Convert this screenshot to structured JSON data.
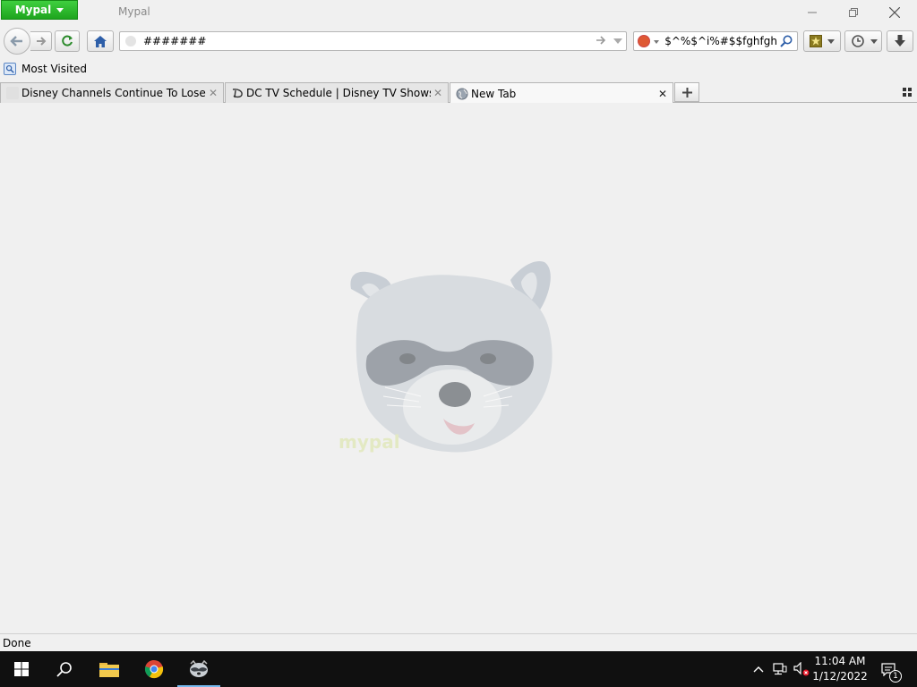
{
  "window": {
    "app_menu_label": "Mypal",
    "title": "Mypal",
    "controls": [
      "minimize-icon",
      "restore-icon",
      "close-icon"
    ]
  },
  "navbar": {
    "back_icon": "back-arrow-icon",
    "forward_icon": "forward-arrow-icon",
    "reload_icon": "reload-icon",
    "home_icon": "home-icon",
    "url_value": "#######",
    "search_value": "i%#$$fghfgh^$%^$%^",
    "search_engine_icon": "duckduckgo-icon",
    "bookmarks_button_icon": "bookmark-star-icon",
    "history_button_icon": "clock-icon",
    "downloads_button_icon": "download-arrow-icon"
  },
  "bookmarks": {
    "items": [
      {
        "label": "Most Visited",
        "icon": "bookmarks-folder-icon"
      }
    ]
  },
  "tabs": [
    {
      "title": "Disney Channels Continue To Lose M...",
      "selected": false,
      "icon": "blank-favicon"
    },
    {
      "title": "DC TV Schedule | Disney TV Shows | P...",
      "selected": false,
      "icon": "disney-channel-icon"
    },
    {
      "title": "New Tab",
      "selected": true,
      "icon": "globe-icon"
    }
  ],
  "content": {
    "image": "raccoon-logo-watermark",
    "watermark_text": "mypal"
  },
  "status": {
    "text": "Done"
  },
  "taskbar": {
    "apps": [
      "windows-start-icon",
      "search-icon",
      "file-explorer-icon",
      "chrome-icon",
      "mypal-raccoon-icon"
    ],
    "active_app": "mypal-raccoon-icon",
    "tray_icons": [
      "chevron-up-icon",
      "network-icon",
      "volume-muted-icon"
    ],
    "time": "11:04 AM",
    "date": "1/12/2022",
    "notification_count": "1"
  },
  "colors": {
    "app_menu_green": "#1ea51e",
    "taskbar_bg": "#101010",
    "chrome_bg": "#f0f0f0"
  }
}
